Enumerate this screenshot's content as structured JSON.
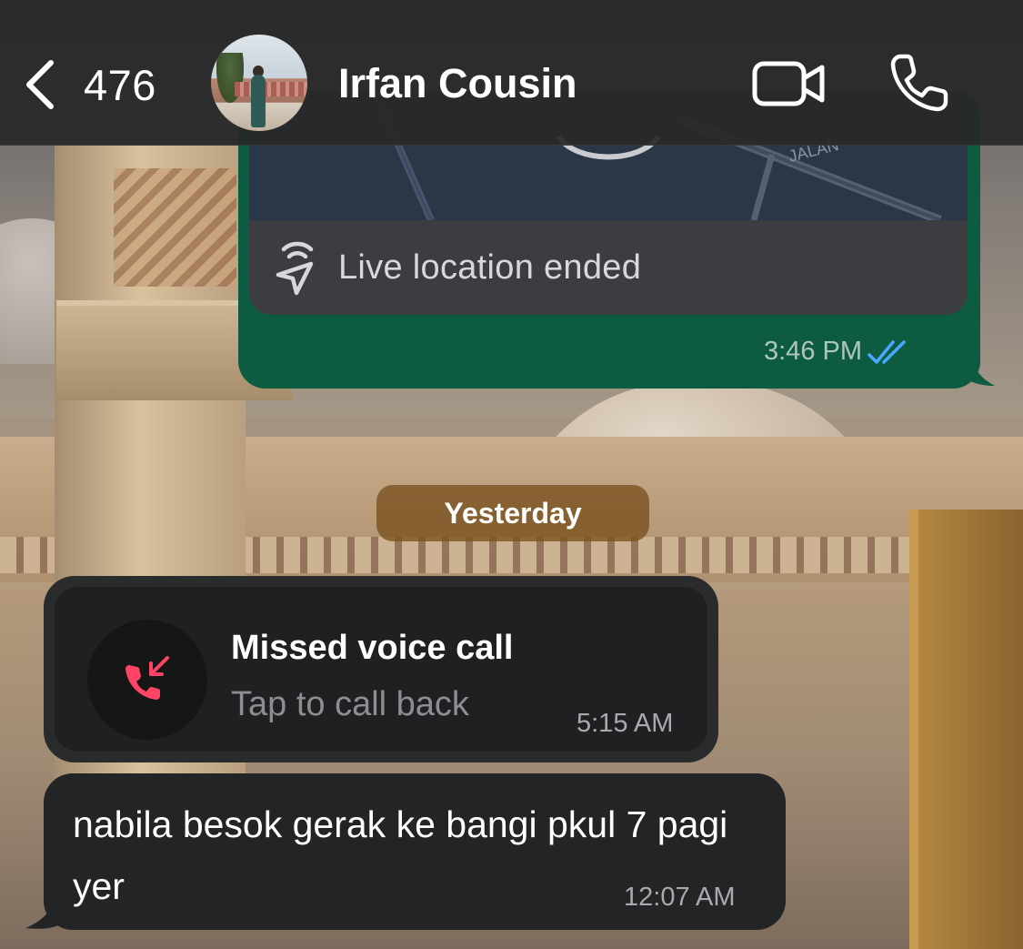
{
  "header": {
    "back_count": "476",
    "contact_name": "Irfan Cousin",
    "icons": [
      "chevron-left-icon",
      "video-camera-icon",
      "phone-icon"
    ]
  },
  "messages": {
    "location": {
      "map_street_label": "JALAN",
      "status_text": "Live location ended",
      "time": "3:46 PM",
      "read_status": "read",
      "tick_color": "#4aa8ff"
    },
    "date_separator": "Yesterday",
    "missed_call": {
      "title": "Missed voice call",
      "subtitle": "Tap to call back",
      "time": "5:15 AM",
      "icon_color": "#ff4466"
    },
    "text": {
      "body": "nabila besok gerak ke bangi pkul 7 pagi yer",
      "time": "12:07 AM"
    }
  },
  "colors": {
    "outgoing_bubble": "#0d5b40",
    "incoming_bubble": "#232426",
    "header": "#282828"
  }
}
